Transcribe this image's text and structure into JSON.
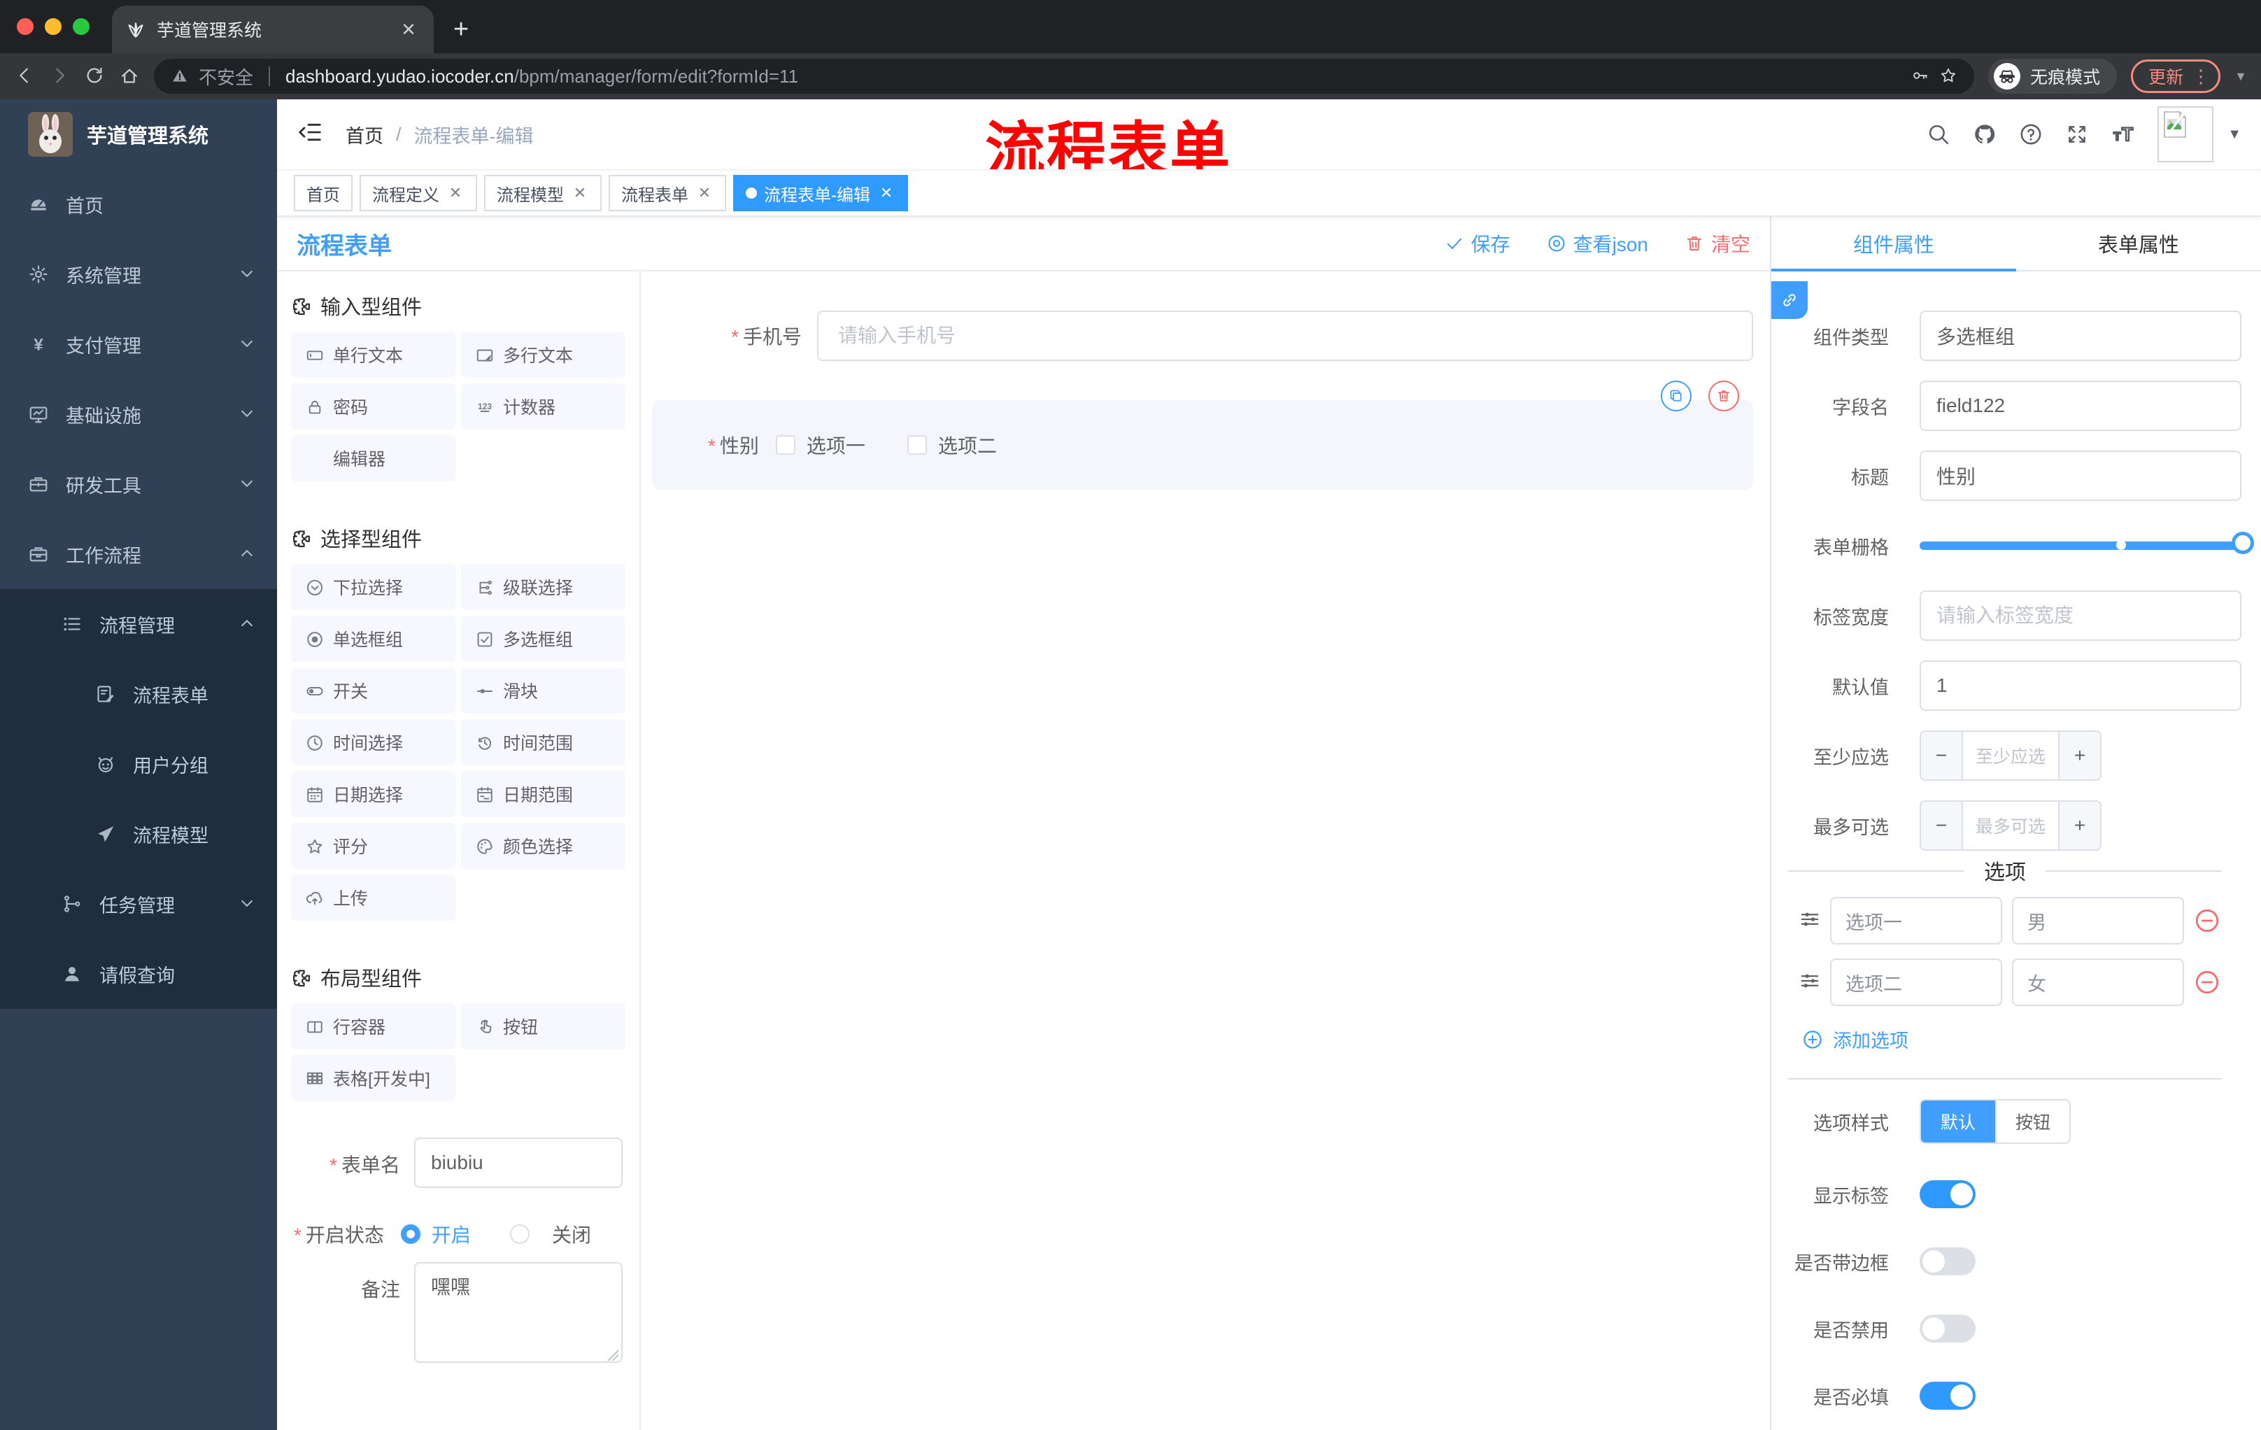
{
  "browser": {
    "tab_title": "芋道管理系统",
    "secure_label": "不安全",
    "url_domain": "dashboard.yudao.iocoder.cn",
    "url_path": "/bpm/manager/form/edit?formId=11",
    "incognito_label": "无痕模式",
    "update_label": "更新"
  },
  "sidebar": {
    "logo_title": "芋道管理系统",
    "top_items": [
      {
        "label": "首页",
        "icon": "dashboard-icon",
        "chevron": null
      },
      {
        "label": "系统管理",
        "icon": "gear-icon",
        "chevron": "down"
      },
      {
        "label": "支付管理",
        "icon": "yen-icon",
        "chevron": "down"
      },
      {
        "label": "基础设施",
        "icon": "monitor-icon",
        "chevron": "down"
      },
      {
        "label": "研发工具",
        "icon": "toolbox-icon",
        "chevron": "down"
      },
      {
        "label": "工作流程",
        "icon": "briefcase-icon",
        "chevron": "up"
      }
    ],
    "sub_items": [
      {
        "label": "流程管理",
        "icon": "list-icon",
        "chevron": "up",
        "level": 2
      },
      {
        "label": "流程表单",
        "icon": "document-icon",
        "chevron": null,
        "level": 3
      },
      {
        "label": "用户分组",
        "icon": "robot-icon",
        "chevron": null,
        "level": 3
      },
      {
        "label": "流程模型",
        "icon": "plane-icon",
        "chevron": null,
        "level": 3
      },
      {
        "label": "任务管理",
        "icon": "tree-icon",
        "chevron": "down",
        "level": 2
      },
      {
        "label": "请假查询",
        "icon": "user-icon",
        "chevron": null,
        "level": 2
      }
    ]
  },
  "header": {
    "breadcrumb": [
      "首页",
      "流程表单-编辑"
    ],
    "separator": "/",
    "annotation": "流程表单"
  },
  "tags": [
    {
      "label": "首页",
      "closable": false,
      "active": false
    },
    {
      "label": "流程定义",
      "closable": true,
      "active": false
    },
    {
      "label": "流程模型",
      "closable": true,
      "active": false
    },
    {
      "label": "流程表单",
      "closable": true,
      "active": false
    },
    {
      "label": "流程表单-编辑",
      "closable": true,
      "active": true
    }
  ],
  "designer": {
    "title": "流程表单",
    "actions": {
      "save": "保存",
      "view_json": "查看json",
      "clear": "清空"
    },
    "components_panel": {
      "sections": [
        {
          "title": "输入型组件",
          "items": [
            {
              "icon": "input-icon",
              "label": "单行文本"
            },
            {
              "icon": "textarea-icon",
              "label": "多行文本"
            },
            {
              "icon": "lock-icon",
              "label": "密码"
            },
            {
              "icon": "counter-icon",
              "label": "计数器"
            },
            {
              "icon": "none",
              "label": "编辑器"
            }
          ]
        },
        {
          "title": "选择型组件",
          "items": [
            {
              "icon": "select-icon",
              "label": "下拉选择"
            },
            {
              "icon": "cascade-icon",
              "label": "级联选择"
            },
            {
              "icon": "radio-icon",
              "label": "单选框组"
            },
            {
              "icon": "checkbox-icon",
              "label": "多选框组"
            },
            {
              "icon": "switch-icon",
              "label": "开关"
            },
            {
              "icon": "slider-icon",
              "label": "滑块"
            },
            {
              "icon": "time-icon",
              "label": "时间选择"
            },
            {
              "icon": "time-range-icon",
              "label": "时间范围"
            },
            {
              "icon": "date-icon",
              "label": "日期选择"
            },
            {
              "icon": "date-range-icon",
              "label": "日期范围"
            },
            {
              "icon": "star-icon",
              "label": "评分"
            },
            {
              "icon": "palette-icon",
              "label": "颜色选择"
            },
            {
              "icon": "upload-icon",
              "label": "上传"
            }
          ]
        },
        {
          "title": "布局型组件",
          "items": [
            {
              "icon": "columns-icon",
              "label": "行容器"
            },
            {
              "icon": "pointer-icon",
              "label": "按钮"
            },
            {
              "icon": "table-icon",
              "label": "表格[开发中]"
            }
          ]
        }
      ],
      "form": {
        "name_label": "表单名",
        "name_value": "biubiu",
        "status_label": "开启状态",
        "status_on": "开启",
        "status_off": "关闭",
        "remark_label": "备注",
        "remark_value": "嘿嘿"
      }
    },
    "canvas": {
      "phone_label": "手机号",
      "phone_placeholder": "请输入手机号",
      "gender_label": "性别",
      "gender_options": [
        "选项一",
        "选项二"
      ]
    },
    "props_panel": {
      "tabs": [
        "组件属性",
        "表单属性"
      ],
      "active_tab": 0,
      "rows": [
        {
          "label": "组件类型",
          "type": "select",
          "value": "多选框组"
        },
        {
          "label": "字段名",
          "type": "input",
          "value": "field122"
        },
        {
          "label": "标题",
          "type": "input",
          "value": "性别"
        },
        {
          "label": "表单栅格",
          "type": "slider"
        },
        {
          "label": "标签宽度",
          "type": "input",
          "placeholder": "请输入标签宽度"
        },
        {
          "label": "默认值",
          "type": "input",
          "value": "1"
        },
        {
          "label": "至少应选",
          "type": "stepper",
          "placeholder": "至少应选"
        },
        {
          "label": "最多可选",
          "type": "stepper",
          "placeholder": "最多可选"
        }
      ],
      "options_title": "选项",
      "options": [
        {
          "label": "选项一",
          "value": "男"
        },
        {
          "label": "选项二",
          "value": "女"
        }
      ],
      "add_option": "添加选项",
      "style_label": "选项样式",
      "style_options": [
        "默认",
        "按钮"
      ],
      "style_active": 0,
      "switches": [
        {
          "label": "显示标签",
          "on": true
        },
        {
          "label": "是否带边框",
          "on": false
        },
        {
          "label": "是否禁用",
          "on": false
        },
        {
          "label": "是否必填",
          "on": true
        }
      ]
    }
  },
  "colors": {
    "primary": "#409eff",
    "danger": "#f56c6c",
    "annotation": "#fe0100",
    "sidebar": "#304156",
    "submenu": "#1f2d3d"
  }
}
